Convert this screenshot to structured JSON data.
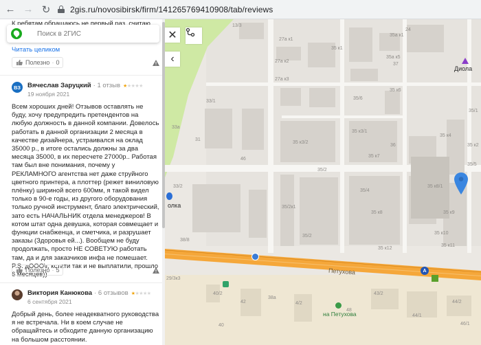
{
  "browser": {
    "url": "2gis.ru/novosibirsk/firm/141265769410908/tab/reviews"
  },
  "search": {
    "placeholder": "Поиск в 2ГИС"
  },
  "snippet_top": "К ребятам обращаюсь не первый раз, считаю",
  "read_more": "Читать целиком",
  "useful_label": "Полезно",
  "reviews": [
    {
      "useful_count": "0"
    },
    {
      "avatar_initials": "ВЗ",
      "name": "Вячеслав Заруцкий",
      "count": "· 1 отзыв",
      "date": "19 ноября 2021",
      "rating": 1,
      "text": "Всем хороших дней! Отзывов оставлять не буду, хочу предупредить претендентов на любую должность в данной компании. Довелось работать в данной организации 2 месяца в качестве дизайнера, устраивался на оклад 35000 р., в итоге остались должны за два месяца 35000, в их пересчете 27000р.. Работая там был вне понимания, почему у РЕКЛАМНОГО агентства нет даже струйного цветного принтера, а плоттер (режет виниловую плёнку) шириной всего 600мм, я такой видел только в 90-е годы, из другого оборудования только ручной инструмент, благо электрический, зато есть НАЧАЛЬНИК отдела менеджеров! В котом штат одна девушка, которая совмещает и функции снабженца, и сметчика, и разрушает заказы (Здоровья ей...). Вообщем не буду продолжать, просто НЕ СОВЕТУЮ работать там, да и для заказчиков инфа не помешает. P.S. дООО\\г, кстати так и не выплатили, прошло 6 месяцев))",
      "useful_count": "5"
    },
    {
      "name": "Виктория Канюкова",
      "count": "· 6 отзывов",
      "date": "6 сентября 2021",
      "rating": 1,
      "text": "Добрый день, более неадекватного руководства я не встречала. Ни в коем случае не обращайтесь и обходите данную организацию на большом расстоянии."
    }
  ],
  "map": {
    "labels": [
      {
        "t": "13/3"
      },
      {
        "t": "27а к1"
      },
      {
        "t": "27а к2"
      },
      {
        "t": "27а к3"
      },
      {
        "t": "35а к1"
      },
      {
        "t": "35 к1"
      },
      {
        "t": "35а к5"
      },
      {
        "t": "35 к6"
      },
      {
        "t": "35 к3/1"
      },
      {
        "t": "35 к3/2"
      },
      {
        "t": "35 к7"
      },
      {
        "t": "35 к4"
      },
      {
        "t": "35 к2"
      },
      {
        "t": "35/2"
      },
      {
        "t": "35/2к1"
      },
      {
        "t": "35 к8"
      },
      {
        "t": "35 к8/1"
      },
      {
        "t": "35 к9"
      },
      {
        "t": "35 к10"
      },
      {
        "t": "35 к11"
      },
      {
        "t": "35 к12"
      },
      {
        "t": "33/2"
      },
      {
        "t": "33а"
      },
      {
        "t": "38/8"
      },
      {
        "t": "29/3к3"
      },
      {
        "t": "4/2"
      },
      {
        "t": "43/2"
      },
      {
        "t": "42"
      },
      {
        "t": "44/2"
      },
      {
        "t": "44/1"
      },
      {
        "t": "46/1"
      },
      {
        "t": "40/2"
      },
      {
        "t": "40"
      },
      {
        "t": "31"
      },
      {
        "t": "35/1"
      },
      {
        "t": "35/5"
      },
      {
        "t": "35/6"
      },
      {
        "t": "36"
      },
      {
        "t": "35/2"
      },
      {
        "t": "24"
      },
      {
        "t": "46"
      },
      {
        "t": "48"
      },
      {
        "t": "35/4"
      },
      {
        "t": "37"
      },
      {
        "t": "33/1"
      },
      {
        "t": "38а"
      }
    ],
    "poi_diola": "Диола",
    "poi_left": "олка",
    "street": "Петухова",
    "park": "на Петухова"
  }
}
